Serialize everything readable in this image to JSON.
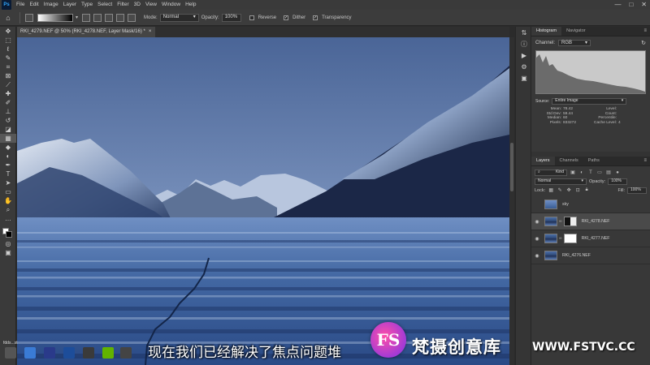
{
  "app": {
    "logo": "Ps"
  },
  "menu": [
    "File",
    "Edit",
    "Image",
    "Layer",
    "Type",
    "Select",
    "Filter",
    "3D",
    "View",
    "Window",
    "Help"
  ],
  "window_controls": {
    "minimize": "—",
    "maximize": "□",
    "close": "✕"
  },
  "options_bar": {
    "mode_label": "Mode:",
    "mode_value": "Normal",
    "opacity_label": "Opacity:",
    "opacity_value": "100%",
    "reverse_label": "Reverse",
    "dither_label": "Dither",
    "transparency_label": "Transparency"
  },
  "document": {
    "tab_title": "RKI_4279.NEF @ 50% (RKI_4278.NEF, Layer Mask/16) *",
    "close": "×"
  },
  "histogram_panel": {
    "tabs": [
      "Histogram",
      "Navigator"
    ],
    "channel_label": "Channel:",
    "channel_value": "RGB",
    "source_label": "Source:",
    "source_value": "Entire Image",
    "stats": [
      {
        "key": "Mean:",
        "value": "78.42",
        "key2": "Level:",
        "value2": ""
      },
      {
        "key": "Std Dev:",
        "value": "59.44",
        "key2": "Count:",
        "value2": ""
      },
      {
        "key": "Median:",
        "value": "60",
        "key2": "Percentile:",
        "value2": ""
      },
      {
        "key": "Pixels:",
        "value": "833272",
        "key2": "Cache Level:",
        "value2": "4"
      }
    ]
  },
  "layers_panel": {
    "tabs": [
      "Layers",
      "Channels",
      "Paths"
    ],
    "kind_label": "Kind",
    "blend_mode": "Normal",
    "opacity_label": "Opacity:",
    "opacity_value": "100%",
    "lock_label": "Lock:",
    "fill_label": "Fill:",
    "fill_value": "100%",
    "layers": [
      {
        "name": "sky",
        "visible": false,
        "selected": false,
        "has_mask": false
      },
      {
        "name": "RKI_4278.NEF",
        "visible": true,
        "selected": true,
        "has_mask": true
      },
      {
        "name": "RKI_4277.NEF",
        "visible": true,
        "selected": false,
        "has_mask": true
      },
      {
        "name": "RKI_4276.NEF",
        "visible": true,
        "selected": false,
        "has_mask": false
      }
    ]
  },
  "subtitle": "现在我们已经解决了焦点问题堆",
  "watermark": {
    "logo": "FS",
    "brand": "梵摄创意库",
    "url": "WWW.FSTVC.CC"
  },
  "taskbar_label": "fdds...st"
}
